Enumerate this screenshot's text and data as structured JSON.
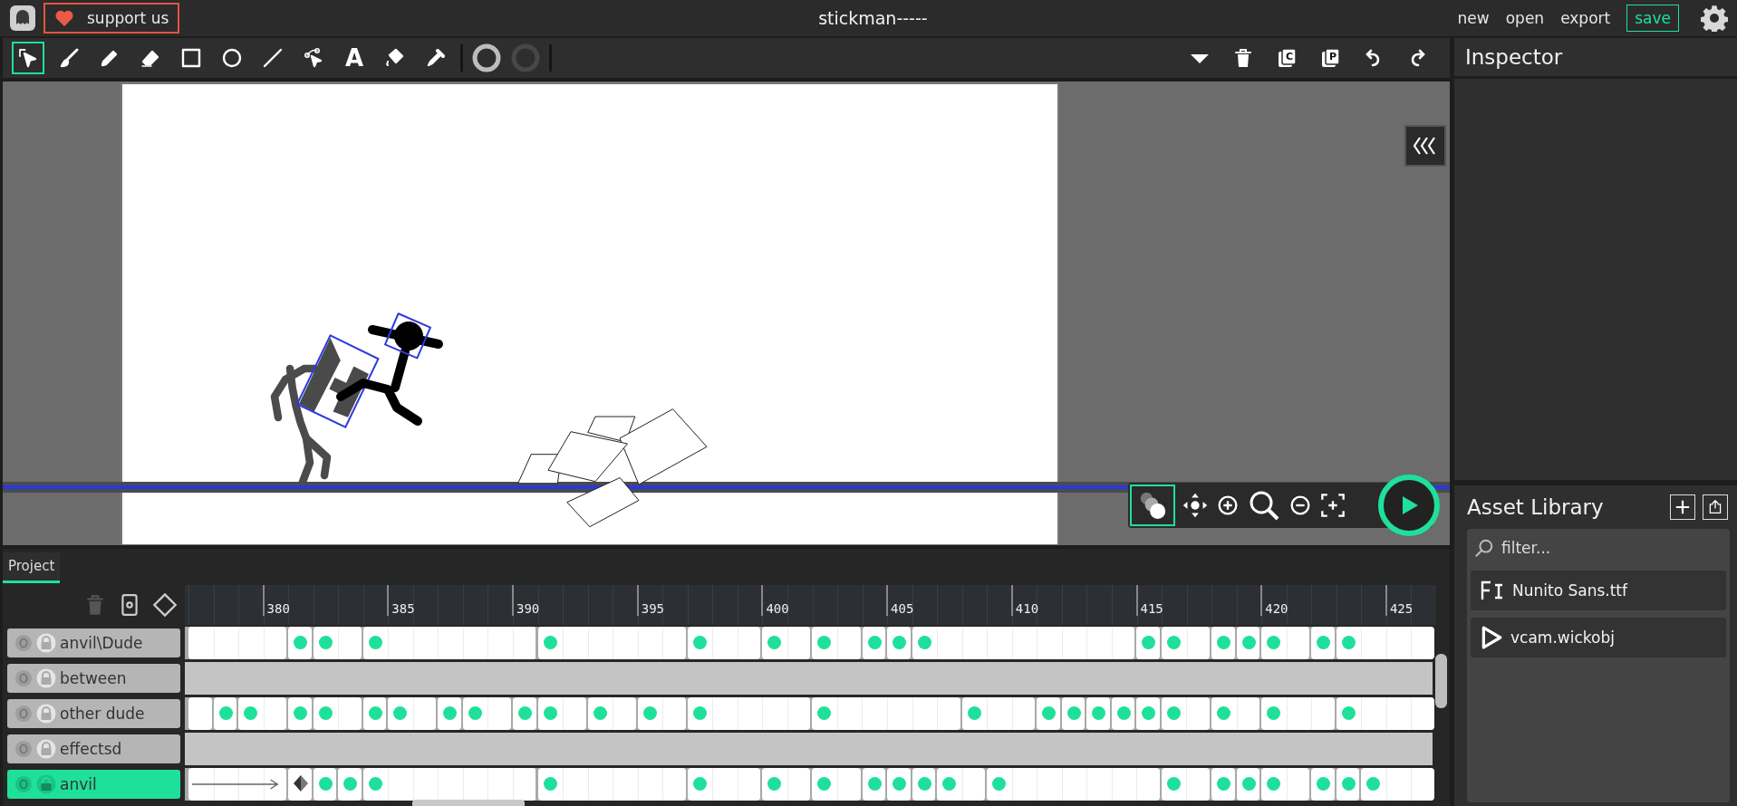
{
  "top_bar": {
    "support_button": "support us",
    "title": "stickman-----",
    "menu": [
      "new",
      "open",
      "export"
    ],
    "save_button": "save"
  },
  "toolbar": {
    "tools": [
      {
        "kind": "select",
        "selected": true
      },
      {
        "kind": "brush",
        "selected": false
      },
      {
        "kind": "pencil",
        "selected": false
      },
      {
        "kind": "eraser",
        "selected": false
      },
      {
        "kind": "rectangle",
        "selected": false
      },
      {
        "kind": "ellipse",
        "selected": false
      },
      {
        "kind": "line",
        "selected": false
      },
      {
        "kind": "path",
        "selected": false
      },
      {
        "kind": "text",
        "label": "A",
        "selected": false
      },
      {
        "kind": "fill",
        "selected": false
      },
      {
        "kind": "eyedropper",
        "selected": false
      }
    ],
    "actions": [
      {
        "kind": "dropdown"
      },
      {
        "kind": "delete"
      },
      {
        "kind": "copy",
        "label": "C"
      },
      {
        "kind": "paste",
        "label": "P"
      },
      {
        "kind": "undo"
      },
      {
        "kind": "redo"
      }
    ]
  },
  "canvas": {
    "onion_skin": {
      "on": true
    },
    "controls": [
      {
        "kind": "pan"
      },
      {
        "kind": "zoom_in"
      },
      {
        "kind": "zoom"
      },
      {
        "kind": "zoom_out"
      },
      {
        "kind": "recenter"
      },
      {
        "kind": "play"
      }
    ]
  },
  "inspector": {
    "title": "Inspector"
  },
  "asset_library": {
    "title": "Asset Library",
    "filter": {
      "placeholder": "filter..."
    },
    "assets": [
      {
        "kind": "font",
        "name": "Nunito Sans.ttf"
      },
      {
        "kind": "clip",
        "name": "vcam.wickobj"
      }
    ]
  },
  "timeline": {
    "tab": "Project",
    "ruler": [
      "380",
      "385",
      "390",
      "395",
      "400",
      "405",
      "410",
      "415",
      "420",
      "425"
    ],
    "layers": [
      {
        "name": "anvil\\Dude",
        "selected": false,
        "tween": false,
        "keyframes": [
          false,
          false,
          false,
          false,
          true,
          true,
          false,
          true,
          false,
          false,
          false,
          false,
          false,
          false,
          true,
          false,
          false,
          false,
          false,
          false,
          true,
          false,
          false,
          true,
          false,
          true,
          false,
          true,
          true,
          true,
          false,
          false,
          false,
          false,
          false,
          false,
          false,
          false,
          true,
          true,
          false,
          true,
          true,
          true,
          false,
          true,
          true,
          false,
          false,
          false
        ]
      },
      {
        "name": "between",
        "selected": false,
        "tween": false
      },
      {
        "name": "other dude",
        "selected": false,
        "tween": false,
        "keyframes": [
          false,
          true,
          true,
          false,
          true,
          true,
          false,
          true,
          true,
          false,
          true,
          true,
          false,
          true,
          true,
          false,
          true,
          false,
          true,
          false,
          true,
          false,
          false,
          false,
          false,
          true,
          false,
          false,
          false,
          false,
          false,
          true,
          false,
          false,
          true,
          true,
          true,
          true,
          true,
          true,
          false,
          true,
          false,
          true,
          false,
          false,
          true,
          false,
          false,
          false
        ]
      },
      {
        "name": "effectsd",
        "selected": false,
        "tween": false
      },
      {
        "name": "anvil",
        "selected": true,
        "tween": true,
        "keyframes": [
          false,
          false,
          false,
          false,
          true,
          true,
          true,
          true,
          false,
          false,
          false,
          false,
          false,
          false,
          true,
          false,
          false,
          false,
          false,
          false,
          true,
          false,
          false,
          true,
          false,
          true,
          false,
          true,
          true,
          true,
          true,
          false,
          true,
          false,
          false,
          false,
          false,
          false,
          false,
          true,
          false,
          true,
          true,
          true,
          false,
          true,
          true,
          true,
          false,
          false
        ]
      }
    ]
  }
}
